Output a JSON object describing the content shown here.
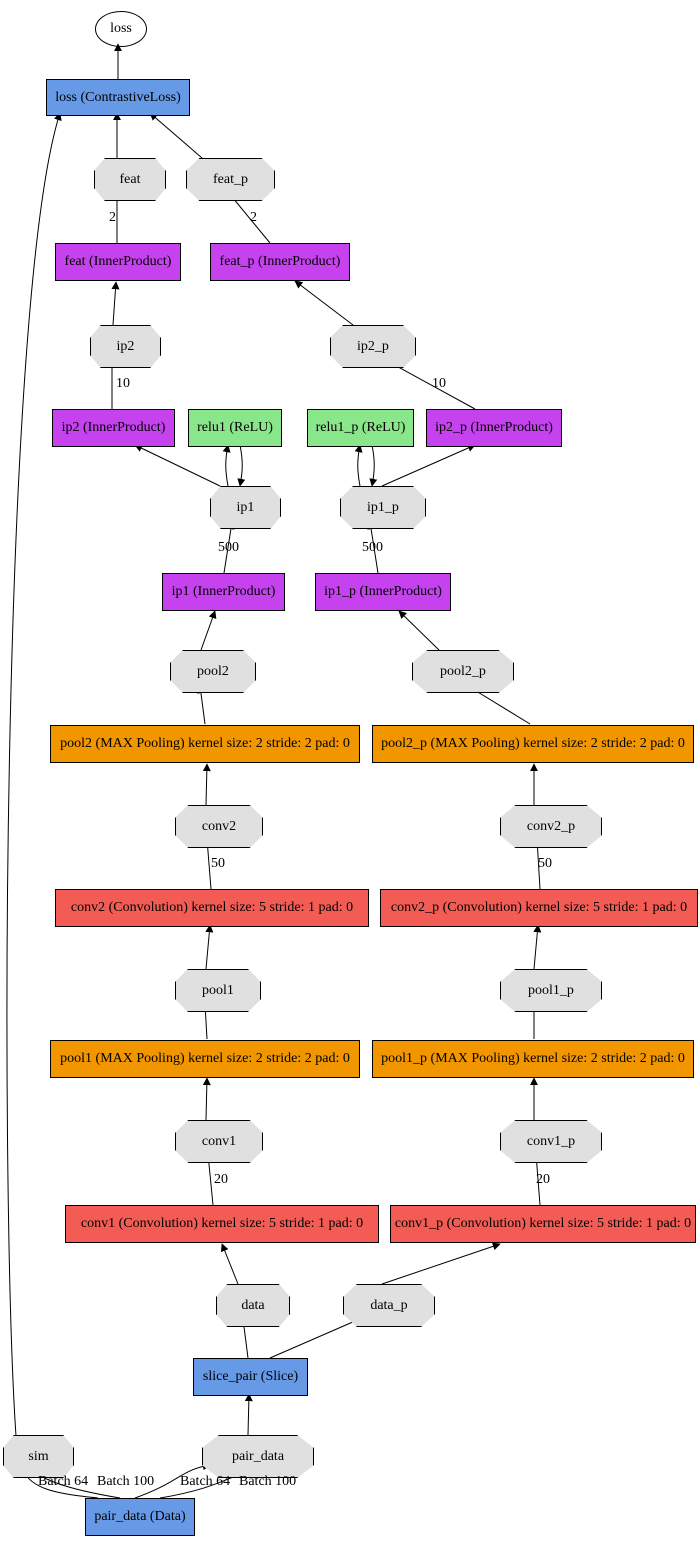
{
  "diagram": {
    "loss_out": "loss",
    "loss_layer": "loss (ContrastiveLoss)",
    "feat": "feat",
    "feat_p": "feat_p",
    "feat_ip": "feat (InnerProduct)",
    "feat_p_ip": "feat_p (InnerProduct)",
    "ip2": "ip2",
    "ip2_p": "ip2_p",
    "ip2_layer": "ip2 (InnerProduct)",
    "relu1": "relu1 (ReLU)",
    "relu1_p": "relu1_p (ReLU)",
    "ip2_p_layer": "ip2_p (InnerProduct)",
    "ip1_oct": "ip1",
    "ip1_p_oct": "ip1_p",
    "ip1_layer": "ip1 (InnerProduct)",
    "ip1_p_layer": "ip1_p (InnerProduct)",
    "pool2": "pool2",
    "pool2_p": "pool2_p",
    "pool2_layer": "pool2 (MAX Pooling) kernel size: 2 stride: 2 pad: 0",
    "pool2_p_layer": "pool2_p (MAX Pooling) kernel size: 2 stride: 2 pad: 0",
    "conv2": "conv2",
    "conv2_p": "conv2_p",
    "conv2_layer": "conv2 (Convolution) kernel size: 5 stride: 1 pad: 0",
    "conv2_p_layer": "conv2_p (Convolution) kernel size: 5 stride: 1 pad: 0",
    "pool1": "pool1",
    "pool1_p": "pool1_p",
    "pool1_layer": "pool1 (MAX Pooling) kernel size: 2 stride: 2 pad: 0",
    "pool1_p_layer": "pool1_p (MAX Pooling) kernel size: 2 stride: 2 pad: 0",
    "conv1": "conv1",
    "conv1_p": "conv1_p",
    "conv1_layer": "conv1 (Convolution) kernel size: 5 stride: 1 pad: 0",
    "conv1_p_layer": "conv1_p (Convolution) kernel size: 5 stride: 1 pad: 0",
    "data": "data",
    "data_p": "data_p",
    "slice_pair": "slice_pair (Slice)",
    "sim": "sim",
    "pair_data": "pair_data",
    "pair_data_layer": "pair_data (Data)",
    "lbl2_a": "2",
    "lbl2_b": "2",
    "lbl10_a": "10",
    "lbl10_b": "10",
    "lbl500_a": "500",
    "lbl500_b": "500",
    "lbl50_a": "50",
    "lbl50_b": "50",
    "lbl20_a": "20",
    "lbl20_b": "20",
    "batch64_a": "Batch 64",
    "batch100_a": "Batch 100",
    "batch64_b": "Batch 64",
    "batch100_b": "Batch 100"
  },
  "chart_data": {
    "type": "diagram",
    "description": "Siamese neural network architecture graph (Caffe-style)",
    "nodes": [
      {
        "id": "loss_out",
        "shape": "ellipse",
        "label": "loss",
        "color": "#ffffff"
      },
      {
        "id": "loss_layer",
        "shape": "box",
        "label": "loss (ContrastiveLoss)",
        "color": "#6699e6"
      },
      {
        "id": "feat",
        "shape": "octagon",
        "label": "feat",
        "color": "#e0e0e0"
      },
      {
        "id": "feat_p",
        "shape": "octagon",
        "label": "feat_p",
        "color": "#e0e0e0"
      },
      {
        "id": "feat_ip",
        "shape": "box",
        "label": "feat (InnerProduct)",
        "color": "#c642ee"
      },
      {
        "id": "feat_p_ip",
        "shape": "box",
        "label": "feat_p (InnerProduct)",
        "color": "#c642ee"
      },
      {
        "id": "ip2",
        "shape": "octagon",
        "label": "ip2",
        "color": "#e0e0e0"
      },
      {
        "id": "ip2_p",
        "shape": "octagon",
        "label": "ip2_p",
        "color": "#e0e0e0"
      },
      {
        "id": "ip2_layer",
        "shape": "box",
        "label": "ip2 (InnerProduct)",
        "color": "#c642ee"
      },
      {
        "id": "relu1",
        "shape": "box",
        "label": "relu1 (ReLU)",
        "color": "#8ae68a"
      },
      {
        "id": "relu1_p",
        "shape": "box",
        "label": "relu1_p (ReLU)",
        "color": "#8ae68a"
      },
      {
        "id": "ip2_p_layer",
        "shape": "box",
        "label": "ip2_p (InnerProduct)",
        "color": "#c642ee"
      },
      {
        "id": "ip1_oct",
        "shape": "octagon",
        "label": "ip1",
        "color": "#e0e0e0"
      },
      {
        "id": "ip1_p_oct",
        "shape": "octagon",
        "label": "ip1_p",
        "color": "#e0e0e0"
      },
      {
        "id": "ip1_layer",
        "shape": "box",
        "label": "ip1 (InnerProduct)",
        "color": "#c642ee"
      },
      {
        "id": "ip1_p_layer",
        "shape": "box",
        "label": "ip1_p (InnerProduct)",
        "color": "#c642ee"
      },
      {
        "id": "pool2",
        "shape": "octagon",
        "label": "pool2",
        "color": "#e0e0e0"
      },
      {
        "id": "pool2_p",
        "shape": "octagon",
        "label": "pool2_p",
        "color": "#e0e0e0"
      },
      {
        "id": "pool2_layer",
        "shape": "box",
        "label": "pool2 (MAX Pooling) kernel size: 2 stride: 2 pad: 0",
        "color": "#f29600"
      },
      {
        "id": "pool2_p_layer",
        "shape": "box",
        "label": "pool2_p (MAX Pooling) kernel size: 2 stride: 2 pad: 0",
        "color": "#f29600"
      },
      {
        "id": "conv2",
        "shape": "octagon",
        "label": "conv2",
        "color": "#e0e0e0"
      },
      {
        "id": "conv2_p",
        "shape": "octagon",
        "label": "conv2_p",
        "color": "#e0e0e0"
      },
      {
        "id": "conv2_layer",
        "shape": "box",
        "label": "conv2 (Convolution) kernel size: 5 stride: 1 pad: 0",
        "color": "#f25c55"
      },
      {
        "id": "conv2_p_layer",
        "shape": "box",
        "label": "conv2_p (Convolution) kernel size: 5 stride: 1 pad: 0",
        "color": "#f25c55"
      },
      {
        "id": "pool1",
        "shape": "octagon",
        "label": "pool1",
        "color": "#e0e0e0"
      },
      {
        "id": "pool1_p",
        "shape": "octagon",
        "label": "pool1_p",
        "color": "#e0e0e0"
      },
      {
        "id": "pool1_layer",
        "shape": "box",
        "label": "pool1 (MAX Pooling) kernel size: 2 stride: 2 pad: 0",
        "color": "#f29600"
      },
      {
        "id": "pool1_p_layer",
        "shape": "box",
        "label": "pool1_p (MAX Pooling) kernel size: 2 stride: 2 pad: 0",
        "color": "#f29600"
      },
      {
        "id": "conv1",
        "shape": "octagon",
        "label": "conv1",
        "color": "#e0e0e0"
      },
      {
        "id": "conv1_p",
        "shape": "octagon",
        "label": "conv1_p",
        "color": "#e0e0e0"
      },
      {
        "id": "conv1_layer",
        "shape": "box",
        "label": "conv1 (Convolution) kernel size: 5 stride: 1 pad: 0",
        "color": "#f25c55"
      },
      {
        "id": "conv1_p_layer",
        "shape": "box",
        "label": "conv1_p (Convolution) kernel size: 5 stride: 1 pad: 0",
        "color": "#f25c55"
      },
      {
        "id": "data",
        "shape": "octagon",
        "label": "data",
        "color": "#e0e0e0"
      },
      {
        "id": "data_p",
        "shape": "octagon",
        "label": "data_p",
        "color": "#e0e0e0"
      },
      {
        "id": "slice_pair",
        "shape": "box",
        "label": "slice_pair (Slice)",
        "color": "#6699e6"
      },
      {
        "id": "sim",
        "shape": "octagon",
        "label": "sim",
        "color": "#e0e0e0"
      },
      {
        "id": "pair_data",
        "shape": "octagon",
        "label": "pair_data",
        "color": "#e0e0e0"
      },
      {
        "id": "pair_data_layer",
        "shape": "box",
        "label": "pair_data (Data)",
        "color": "#6699e6"
      }
    ],
    "edges": [
      {
        "from": "loss_layer",
        "to": "loss_out"
      },
      {
        "from": "feat",
        "to": "loss_layer"
      },
      {
        "from": "feat_p",
        "to": "loss_layer"
      },
      {
        "from": "feat_ip",
        "to": "feat",
        "label": "2"
      },
      {
        "from": "feat_p_ip",
        "to": "feat_p",
        "label": "2"
      },
      {
        "from": "ip2",
        "to": "feat_ip"
      },
      {
        "from": "ip2_p",
        "to": "feat_p_ip"
      },
      {
        "from": "ip2_layer",
        "to": "ip2",
        "label": "10"
      },
      {
        "from": "ip2_p_layer",
        "to": "ip2_p",
        "label": "10"
      },
      {
        "from": "ip1_oct",
        "to": "ip2_layer"
      },
      {
        "from": "ip1_oct",
        "to": "relu1"
      },
      {
        "from": "relu1",
        "to": "ip1_oct"
      },
      {
        "from": "ip1_p_oct",
        "to": "ip2_p_layer"
      },
      {
        "from": "ip1_p_oct",
        "to": "relu1_p"
      },
      {
        "from": "relu1_p",
        "to": "ip1_p_oct"
      },
      {
        "from": "ip1_layer",
        "to": "ip1_oct",
        "label": "500"
      },
      {
        "from": "ip1_p_layer",
        "to": "ip1_p_oct",
        "label": "500"
      },
      {
        "from": "pool2",
        "to": "ip1_layer"
      },
      {
        "from": "pool2_p",
        "to": "ip1_p_layer"
      },
      {
        "from": "pool2_layer",
        "to": "pool2"
      },
      {
        "from": "pool2_p_layer",
        "to": "pool2_p"
      },
      {
        "from": "conv2",
        "to": "pool2_layer"
      },
      {
        "from": "conv2_p",
        "to": "pool2_p_layer"
      },
      {
        "from": "conv2_layer",
        "to": "conv2",
        "label": "50"
      },
      {
        "from": "conv2_p_layer",
        "to": "conv2_p",
        "label": "50"
      },
      {
        "from": "pool1",
        "to": "conv2_layer"
      },
      {
        "from": "pool1_p",
        "to": "conv2_p_layer"
      },
      {
        "from": "pool1_layer",
        "to": "pool1"
      },
      {
        "from": "pool1_p_layer",
        "to": "pool1_p"
      },
      {
        "from": "conv1",
        "to": "pool1_layer"
      },
      {
        "from": "conv1_p",
        "to": "pool1_p_layer"
      },
      {
        "from": "conv1_layer",
        "to": "conv1",
        "label": "20"
      },
      {
        "from": "conv1_p_layer",
        "to": "conv1_p",
        "label": "20"
      },
      {
        "from": "data",
        "to": "conv1_layer"
      },
      {
        "from": "data_p",
        "to": "conv1_p_layer"
      },
      {
        "from": "slice_pair",
        "to": "data"
      },
      {
        "from": "slice_pair",
        "to": "data_p"
      },
      {
        "from": "pair_data",
        "to": "slice_pair"
      },
      {
        "from": "pair_data_layer",
        "to": "pair_data",
        "label": "Batch 64"
      },
      {
        "from": "pair_data_layer",
        "to": "pair_data",
        "label": "Batch 100"
      },
      {
        "from": "pair_data_layer",
        "to": "sim",
        "label": "Batch 64"
      },
      {
        "from": "pair_data_layer",
        "to": "sim",
        "label": "Batch 100"
      },
      {
        "from": "sim",
        "to": "loss_layer"
      }
    ]
  }
}
